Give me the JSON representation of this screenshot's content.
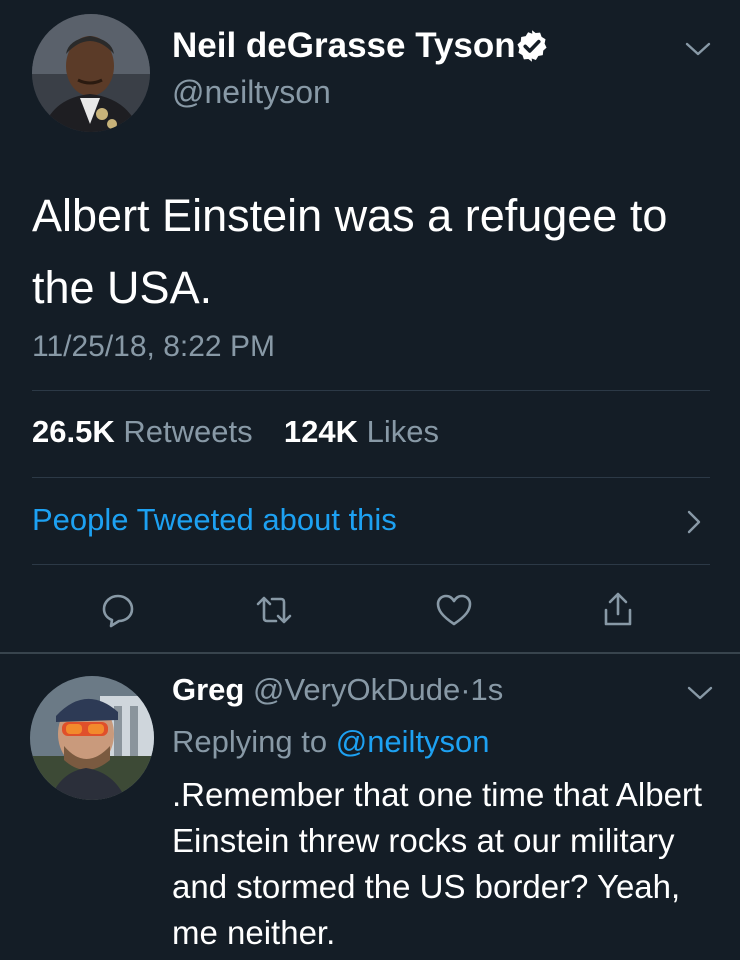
{
  "colors": {
    "background": "#141d26",
    "text_primary": "#ffffff",
    "text_secondary": "#8899a6",
    "link": "#1da1f2",
    "divider": "#2c3946"
  },
  "main_tweet": {
    "author_name": "Neil deGrasse Tyson",
    "author_handle": "@neiltyson",
    "verified_icon": "verified-badge-icon",
    "text": "Albert Einstein was a refugee to the USA.",
    "timestamp": "11/25/18, 8:22 PM",
    "stats": {
      "retweets_count": "26.5K",
      "retweets_label": "Retweets",
      "likes_count": "124K",
      "likes_label": "Likes"
    },
    "people_tweeted_label": "People Tweeted about this",
    "actions": [
      "reply-icon",
      "retweet-icon",
      "like-icon",
      "share-icon"
    ]
  },
  "reply_tweet": {
    "author_name": "Greg",
    "author_handle": "@VeryOkDude",
    "separator": "·",
    "time": "1s",
    "replying_to_label": "Replying to",
    "replying_to_handle": "@neiltyson",
    "text": ".Remember that one time that Albert Einstein threw rocks at our military and stormed the US border? Yeah, me neither."
  }
}
